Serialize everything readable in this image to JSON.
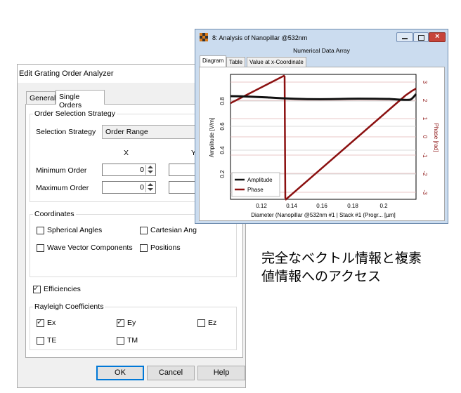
{
  "dialog": {
    "title": "Edit Grating Order Analyzer",
    "tabs": [
      "General",
      "Single Orders"
    ],
    "order_strategy": {
      "group_label": "Order Selection Strategy",
      "strategy_label": "Selection Strategy",
      "strategy_value": "Order Range",
      "col_x": "X",
      "col_y": "Y",
      "min_label": "Minimum Order",
      "max_label": "Maximum Order",
      "min_x": "0",
      "max_x": "0"
    },
    "coordinates": {
      "group_label": "Coordinates",
      "spherical": "Spherical Angles",
      "cartesian": "Cartesian Ang",
      "wave_vector": "Wave Vector Components",
      "positions": "Positions"
    },
    "efficiencies_label": "Efficiencies",
    "rayleigh": {
      "group_label": "Rayleigh Coefficients",
      "ex": "Ex",
      "ey": "Ey",
      "ez": "Ez",
      "te": "TE",
      "tm": "TM"
    },
    "buttons": {
      "ok": "OK",
      "cancel": "Cancel",
      "help": "Help"
    }
  },
  "analysis_window": {
    "title": "8: Analysis of Nanopillar @532nm",
    "subtitle": "Numerical Data Array",
    "tabs": [
      "Diagram",
      "Table",
      "Value at x-Coordinate"
    ]
  },
  "chart_data": {
    "type": "line",
    "xlabel": "Diameter (Nanopillar @532nm #1 | Stack #1 (Progr... [µm]",
    "ylabel_left": "Amplitude [V/m]",
    "ylabel_right": "Phase [rad]",
    "xlim": [
      0.08,
      0.2
    ]
  },
  "chart_text": {
    "x_ticks": [
      "0.12",
      "0.14",
      "0.16",
      "0.18",
      "0.2"
    ],
    "y_left_ticks": [
      "0.2",
      "0.4",
      "0.6",
      "0.8"
    ],
    "y_right_ticks": [
      "3",
      "2",
      "1",
      "0",
      "-1",
      "-2",
      "-3"
    ],
    "legend": [
      "Amplitude",
      "Phase"
    ]
  },
  "caption": {
    "line1": "完全なベクトル情報と複素",
    "line2": "値情報へのアクセス"
  },
  "colors": {
    "amplitude": "#111111",
    "phase": "#8b1010",
    "accent": "#0078d7"
  }
}
